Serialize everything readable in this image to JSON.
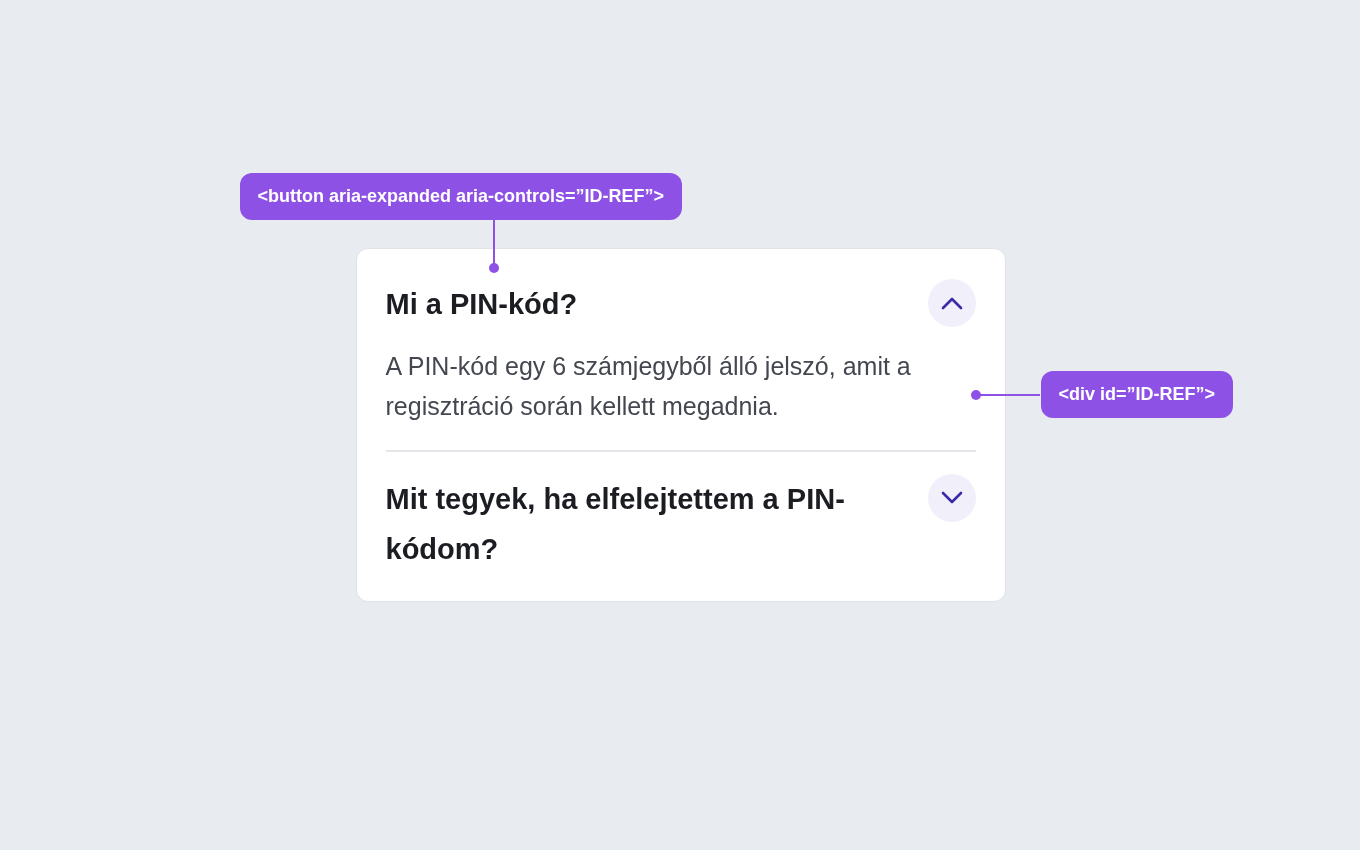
{
  "annotations": [
    {
      "kind": "top",
      "text": "<button aria-expanded aria-controls=”ID-REF”>"
    },
    {
      "kind": "right",
      "text": "<div id=”ID-REF”>"
    }
  ],
  "accordion": {
    "items": [
      {
        "question": "Mi a PIN-kód?",
        "expanded": true,
        "answer": "A PIN-kód egy 6 számjegyből álló jelszó, amit a regisztráció során kellett megadnia."
      },
      {
        "question": "Mit tegyek, ha elfelejtettem a PIN-kódom?",
        "expanded": false
      }
    ]
  }
}
